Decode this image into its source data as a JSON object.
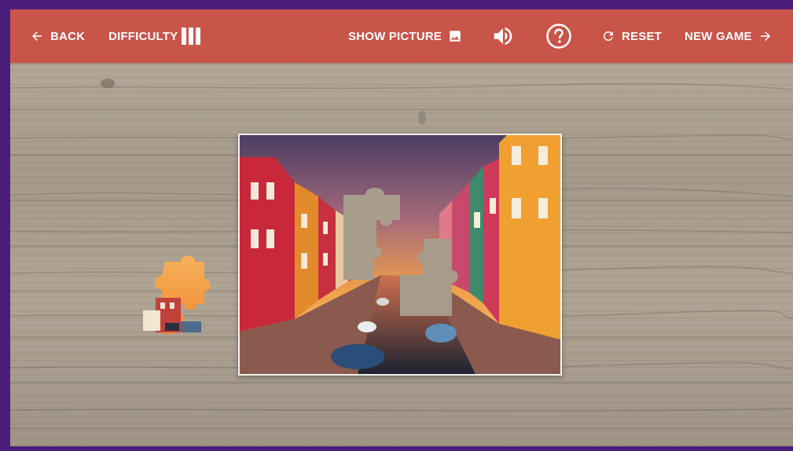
{
  "toolbar": {
    "back_label": "BACK",
    "difficulty_label": "DIFFICULTY",
    "show_picture_label": "SHOW PICTURE",
    "reset_label": "RESET",
    "new_game_label": "NEW GAME"
  },
  "icons": {
    "back": "arrow-left-icon",
    "difficulty": "difficulty-bars-icon",
    "show_picture": "image-icon",
    "sound": "volume-icon",
    "help": "help-circle-icon",
    "reset": "refresh-icon",
    "new_game": "arrow-right-icon"
  },
  "colors": {
    "toolbar": "#c9544a",
    "frame": "#4b1d7a",
    "board": "#a99e8e"
  }
}
